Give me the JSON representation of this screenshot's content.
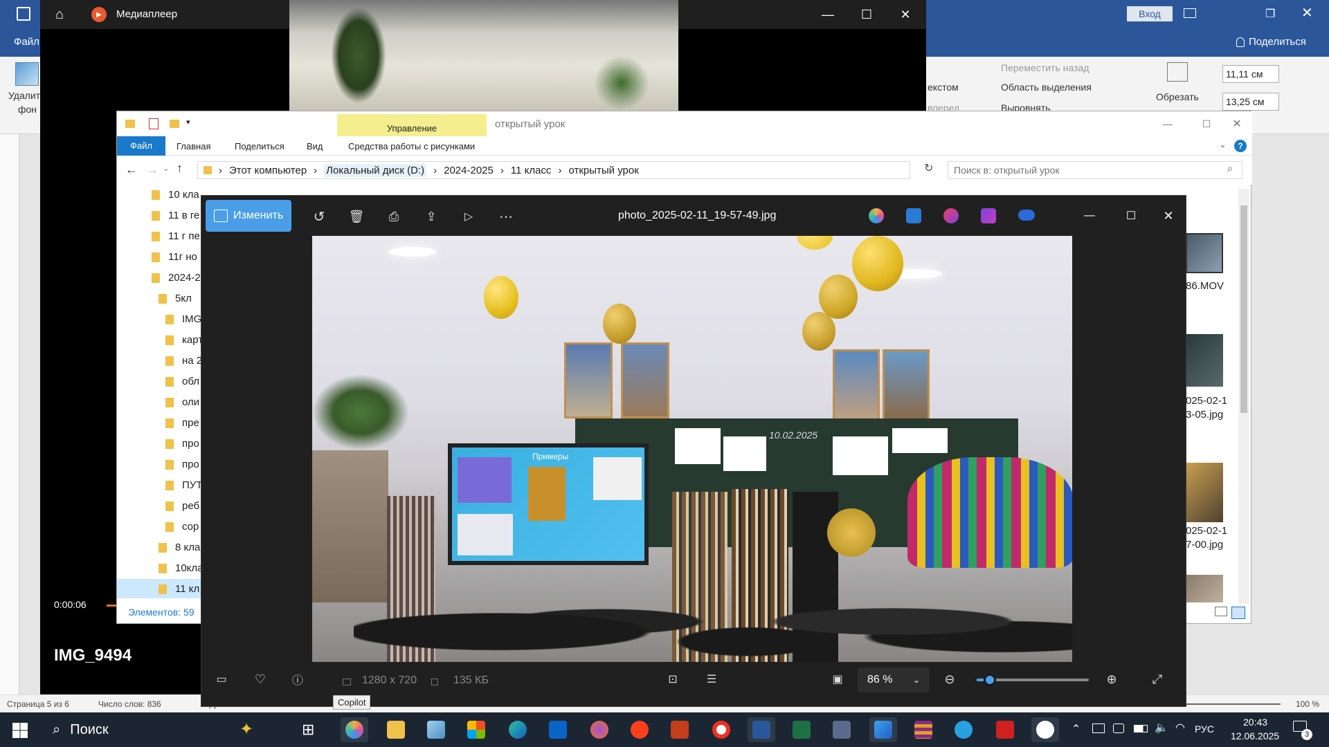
{
  "word": {
    "share_label": "Поделиться",
    "login_label": "Вход",
    "file_tab": "Файл",
    "remove_bg_label_1": "Удалить",
    "remove_bg_label_2": "фон",
    "move_back": "Переместить назад",
    "text_wrap": "екстом",
    "move_forward": "вперед",
    "selection_pane": "Область выделения",
    "align": "Выровнять",
    "crop": "Обрезать",
    "height_value": "11,11 см",
    "width_value": "13,25 см",
    "status_page": "Страница 5 из 6",
    "status_words": "Число слов: 836",
    "status_lang": "русский",
    "zoom": "100 %"
  },
  "media": {
    "title": "Медиаплеер",
    "time": "0:00:06",
    "file_name": "IMG_9494",
    "progress_fraction": 0.02
  },
  "explorer": {
    "title": "открытый урок",
    "manage_tab": "Управление",
    "tabs": [
      "Файл",
      "Главная",
      "Поделиться",
      "Вид"
    ],
    "picture_tools": "Средства работы с рисунками",
    "breadcrumb": [
      "Этот компьютер",
      "Локальный диск (D:)",
      "2024-2025",
      "11 класс",
      "открытый урок"
    ],
    "search_placeholder": "Поиск в: открытый урок",
    "tree": [
      {
        "label": "10 кла",
        "level": 0
      },
      {
        "label": "11 в ге",
        "level": 0
      },
      {
        "label": "11 г пе",
        "level": 0
      },
      {
        "label": "11г но",
        "level": 0
      },
      {
        "label": "2024-2",
        "level": 0
      },
      {
        "label": "5кл",
        "level": 1
      },
      {
        "label": "IMG",
        "level": 2
      },
      {
        "label": "карт",
        "level": 2
      },
      {
        "label": "на 2",
        "level": 2
      },
      {
        "label": "обл",
        "level": 2
      },
      {
        "label": "оли",
        "level": 2
      },
      {
        "label": "пре",
        "level": 2
      },
      {
        "label": "про",
        "level": 2
      },
      {
        "label": "про",
        "level": 2
      },
      {
        "label": "ПУТ",
        "level": 2
      },
      {
        "label": "реб",
        "level": 2
      },
      {
        "label": "сор",
        "level": 2
      },
      {
        "label": "8 кла",
        "level": 1
      },
      {
        "label": "10кла",
        "level": 1
      },
      {
        "label": "11 кл",
        "level": 1
      }
    ],
    "files": [
      {
        "name_1": "86.MOV",
        "name_2": ""
      },
      {
        "name_1": "025-02-1",
        "name_2": "3-05.jpg"
      },
      {
        "name_1": "025-02-1",
        "name_2": "7-00.jpg"
      }
    ],
    "item_count": "Элементов: 59"
  },
  "photos": {
    "edit_label": "Изменить",
    "file_name": "photo_2025-02-11_19-57-49.jpg",
    "dimensions": "1280 x 720",
    "size": "135 КБ",
    "zoom": "86 %",
    "zoom_fraction": 0.12,
    "tooltip": "Copilot",
    "image_texts": {
      "board_title": "Примеры",
      "board_date": "10.02.2025"
    }
  },
  "taskbar": {
    "search_label": "Поиск",
    "lang": "РУС",
    "time": "20:43",
    "date": "12.06.2025",
    "notification_count": "3"
  },
  "colors": {
    "word_blue": "#2b579a",
    "taskbar": "#1c2633",
    "photos_bg": "#202020",
    "accent": "#4a9ee8"
  }
}
